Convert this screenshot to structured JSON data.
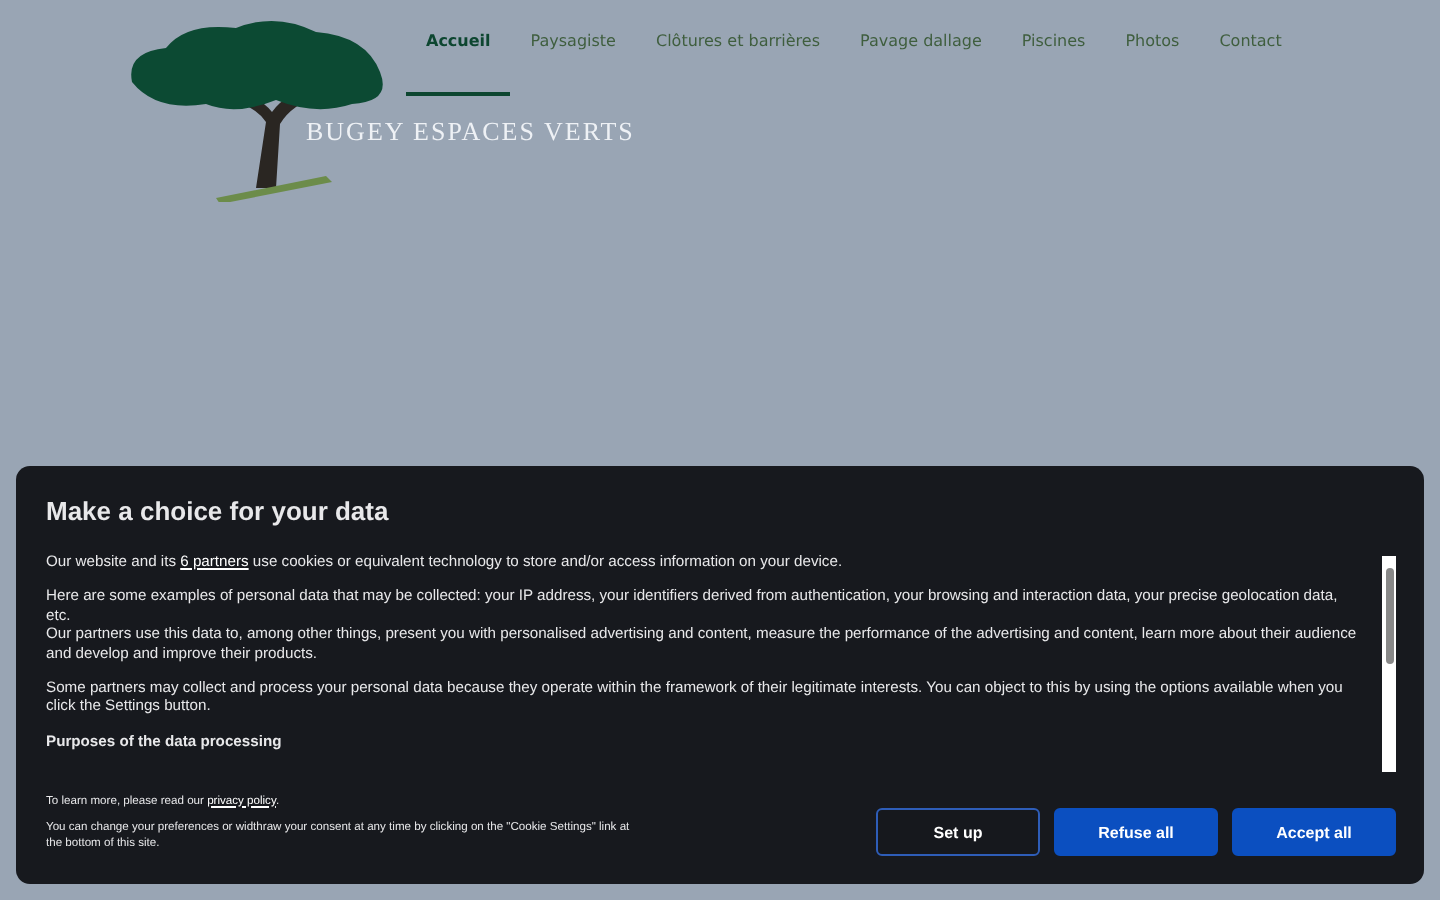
{
  "site": {
    "logo_text": "BUGEY ESPACES VERTS",
    "nav": [
      {
        "label": "Accueil",
        "selected": true
      },
      {
        "label": "Paysagiste",
        "selected": false
      },
      {
        "label": "Clôtures et barrières",
        "selected": false
      },
      {
        "label": "Pavage dallage",
        "selected": false
      },
      {
        "label": "Piscines",
        "selected": false
      },
      {
        "label": "Photos",
        "selected": false
      },
      {
        "label": "Contact",
        "selected": false
      }
    ]
  },
  "cookie_dialog": {
    "title": "Make a choice for your data",
    "intro_prefix": "Our website and its",
    "intro_link": "6 partners",
    "intro_suffix": "use cookies or equivalent technology to store and/or access information on your device.",
    "paragraphs": [
      "Here are some examples of personal data that may be collected: your IP address, your identifiers derived from authentication, your browsing and interaction data, your precise geolocation data, etc.",
      "Our partners use this data to, among other things, present you with personalised advertising and content, measure the performance of the advertising and content, learn more about their audience and develop and improve their products.",
      "Some partners may collect and process your personal data because they operate within the framework of their legitimate interests. You can object to this by using the options available when you click the Settings button."
    ],
    "section_title": "Purposes of the data processing",
    "privacy_prefix": "To learn more, please read our",
    "privacy_link": "privacy policy",
    "privacy_suffix": ".",
    "consent_note": "You can change your preferences or widthraw your consent at any time by clicking on the \"Cookie Settings\" link at the bottom of this site.",
    "buttons": [
      {
        "label": "Set up",
        "kind": "outline"
      },
      {
        "label": "Refuse all",
        "kind": "primary"
      },
      {
        "label": "Accept all",
        "kind": "primary"
      }
    ]
  }
}
